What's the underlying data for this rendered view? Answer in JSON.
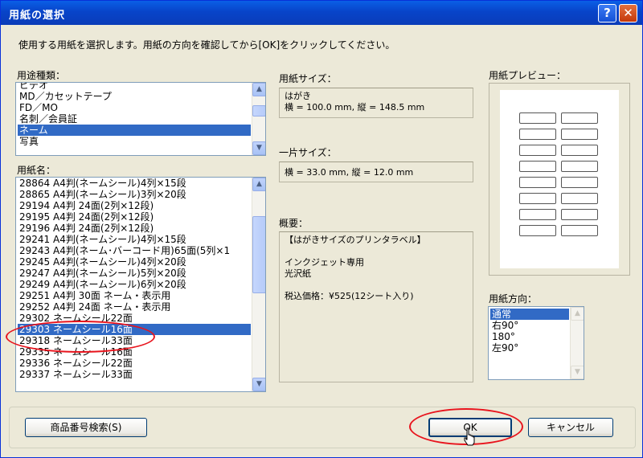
{
  "window": {
    "title": "用紙の選択",
    "help_glyph": "?",
    "close_glyph": "✕"
  },
  "instruction": "使用する用紙を選択します。用紙の方向を確認してから[OK]をクリックしてください。",
  "usage": {
    "label": "用途種類：",
    "items": [
      "ビデオ",
      "MD／カセットテープ",
      "FD／MO",
      "名刺／会員証",
      "ネーム",
      "写真"
    ],
    "selected_index": 4
  },
  "paper_name": {
    "label": "用紙名：",
    "items": [
      "28864 A4判(ネームシール)4列×15段",
      "28865 A4判(ネームシール)3列×20段",
      "29194 A4判 24面(2列×12段)",
      "29195 A4判 24面(2列×12段)",
      "29196 A4判 24面(2列×12段)",
      "29241 A4判(ネームシール)4列×15段",
      "29243 A4判(ネーム･バーコード用)65面(5列×1",
      "29245 A4判(ネームシール)4列×20段",
      "29247 A4判(ネームシール)5列×20段",
      "29249 A4判(ネームシール)6列×20段",
      "29251 A4判 30面 ネーム・表示用",
      "29252 A4判 24面 ネーム・表示用",
      "29302 ネームシール22面",
      "29303 ネームシール16面",
      "29318 ネームシール33面",
      "29335 ネームシール16面",
      "29336 ネームシール22面",
      "29337 ネームシール33面"
    ],
    "selected_index": 13
  },
  "paper_size": {
    "label": "用紙サイズ：",
    "name": "はがき",
    "dims": "横 = 100.0 mm, 縦 = 148.5 mm"
  },
  "piece_size": {
    "label": "一片サイズ：",
    "dims": "横 = 33.0 mm, 縦 = 12.0 mm"
  },
  "summary": {
    "label": "概要：",
    "lines": [
      "【はがきサイズのプリンタラベル】",
      "",
      "インクジェット専用",
      "光沢紙",
      "",
      "税込価格：¥525(12シート入り)"
    ]
  },
  "preview": {
    "label": "用紙プレビュー：",
    "rows": 8,
    "cols": 2
  },
  "orientation": {
    "label": "用紙方向：",
    "items": [
      "通常",
      "右90°",
      "180°",
      "左90°"
    ],
    "selected_index": 0
  },
  "buttons": {
    "product_search": "商品番号検索(S)",
    "ok": "OK",
    "cancel": "キャンセル"
  },
  "annotation_color": "#e8141d"
}
